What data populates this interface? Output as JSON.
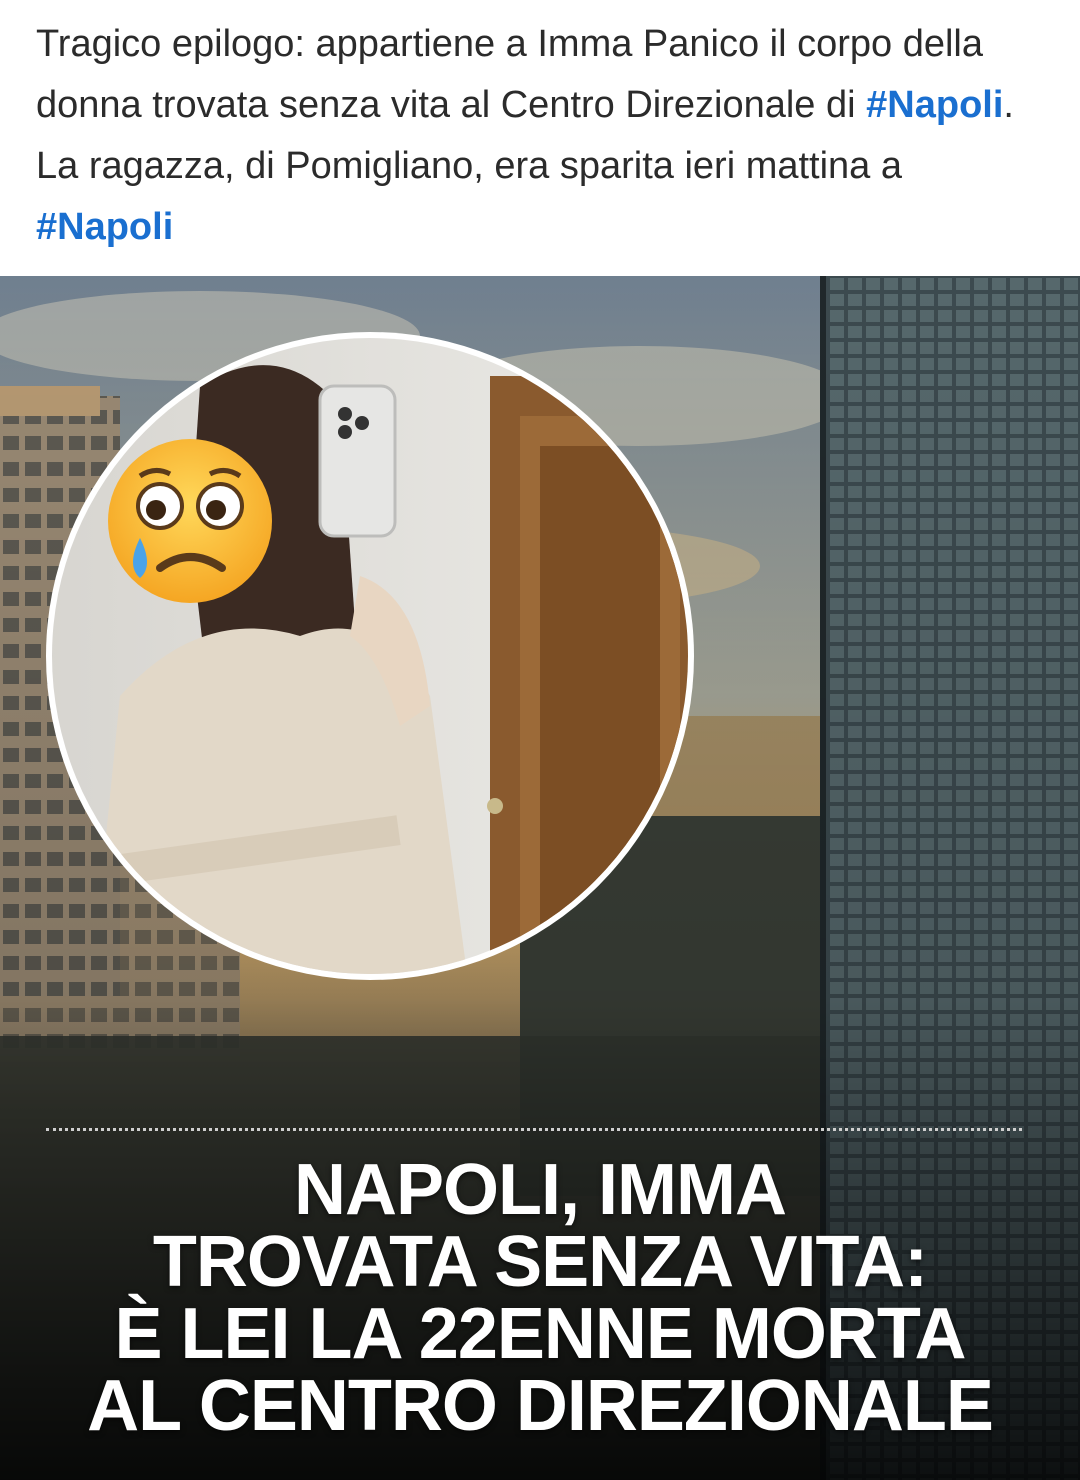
{
  "post": {
    "text_parts": [
      {
        "text": "Tragico epilogo: appartiene a Imma Panico il corpo della donna trovata senza vita al Centro Direzionale di ",
        "type": "text"
      },
      {
        "text": "#Napoli",
        "type": "hashtag"
      },
      {
        "text": ". La ragazza, di Pomigliano, era sparita ieri mattina a ",
        "type": "text"
      },
      {
        "text": "#Napoli",
        "type": "hashtag"
      }
    ]
  },
  "image": {
    "headline": {
      "line1": "NAPOLI, IMMA",
      "line2": "TROVATA SENZA VITA:",
      "line3": "È LEI LA 22ENNE MORTA",
      "line4": "AL CENTRO DIREZIONALE"
    },
    "overlay_icon": "crying-face-emoji",
    "colors": {
      "hashtag": "#1a6fd0",
      "headline": "#ffffff"
    }
  }
}
